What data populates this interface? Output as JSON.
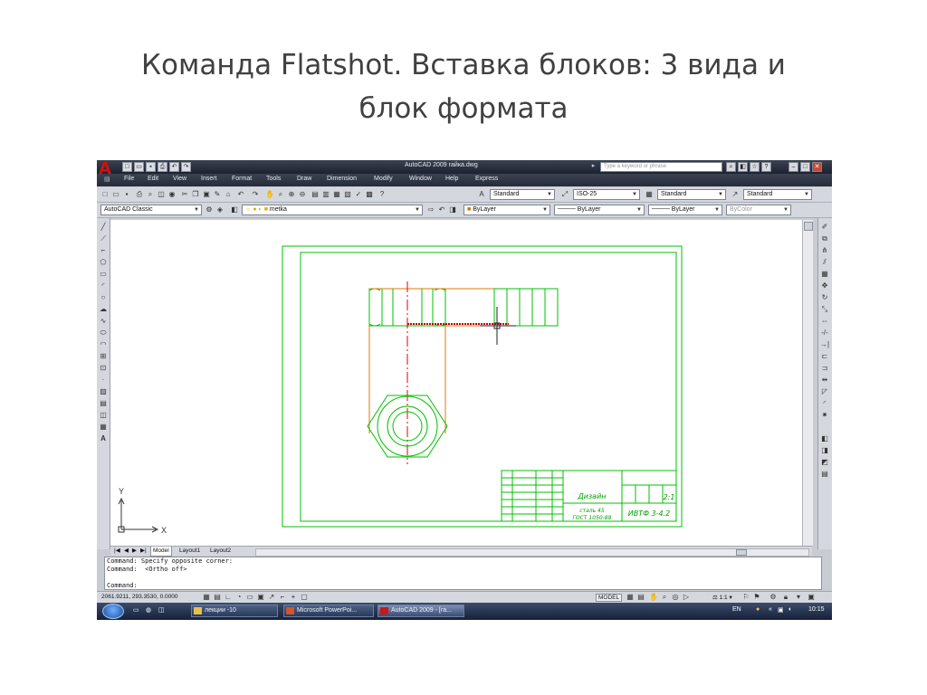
{
  "slide": {
    "title_line1": "Команда Flatshot. Вставка блоков: 3 вида и",
    "title_line2": "блок формата"
  },
  "app": {
    "window_title": "AutoCAD 2009 гайка.dwg",
    "help_search_placeholder": "Type a keyword or phrase"
  },
  "menu": [
    "File",
    "Edit",
    "View",
    "Insert",
    "Format",
    "Tools",
    "Draw",
    "Dimension",
    "Modify",
    "Window",
    "Help",
    "Express"
  ],
  "styles_toolbar": {
    "text_style": "Standard",
    "dim_style": "ISO-25",
    "table_style": "Standard",
    "multileader_style": "Standard"
  },
  "layers_toolbar": {
    "workspace": "AutoCAD Classic",
    "layer_name": "metka",
    "color": "ByLayer",
    "linetype": "ByLayer",
    "lineweight": "ByLayer",
    "plot_style": "ByColor"
  },
  "ucs": {
    "y_label": "Y",
    "x_label": "X"
  },
  "layout_tabs": [
    "Model",
    "Layout1",
    "Layout2"
  ],
  "command_lines": [
    "Command: Specify opposite corner:",
    "Command:  <Ortho off>",
    "",
    "Command:"
  ],
  "status": {
    "coordinates": "2061.9211, 293.3530, 0.0000",
    "model_label": "MODEL",
    "annotation_scale": "1:1"
  },
  "taskbar": {
    "items": [
      {
        "label": "лекции -10",
        "icon": "folder-icon"
      },
      {
        "label": "Microsoft PowerPoi...",
        "icon": "powerpoint-icon"
      },
      {
        "label": "AutoCAD 2009 - [га...",
        "icon": "autocad-icon"
      }
    ],
    "language": "EN",
    "clock": "10:15"
  },
  "title_block": {
    "part_name": "Дизайн",
    "scale_value": "2:1",
    "material_line1": "сталь 45",
    "material_line2": "ГОСТ 1050-88",
    "designation": "ИВТФ 3-4.2"
  },
  "colors": {
    "drawing_line": "#00c000",
    "hidden_line": "#e07a00",
    "center_line": "#e00000",
    "titlebar": "#2a3140",
    "toolbar_bg": "#d4d8de"
  }
}
